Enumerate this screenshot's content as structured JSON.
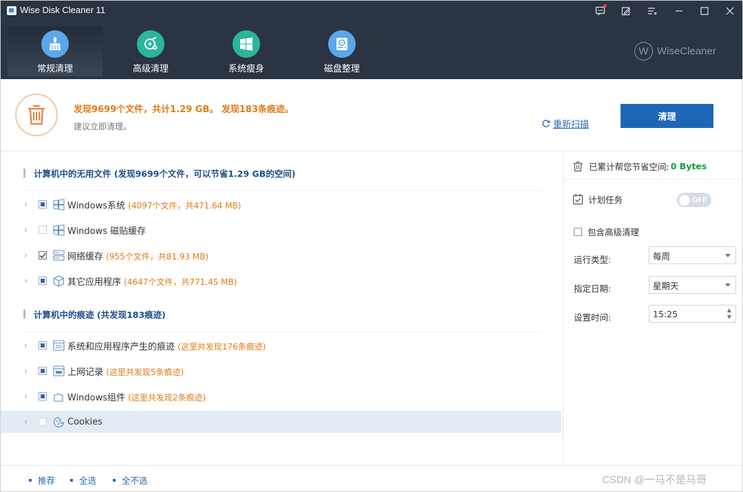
{
  "app": {
    "title": "Wise Disk Cleaner 11"
  },
  "nav": {
    "tabs": [
      {
        "label": "常规清理",
        "active": true,
        "icon": "broom-icon",
        "color": "#5aa7ec"
      },
      {
        "label": "高级清理",
        "active": false,
        "icon": "disc-search-icon",
        "color": "#2bb59a"
      },
      {
        "label": "系统瘦身",
        "active": false,
        "icon": "windows-icon",
        "color": "#2bb59a"
      },
      {
        "label": "磁盘整理",
        "active": false,
        "icon": "hard-disk-icon",
        "color": "#5aa7ec"
      }
    ],
    "logo": "WiseCleaner"
  },
  "summary": {
    "line1": "发现9699个文件，共计1.29 GB。 发现183条痕迹。",
    "line2": "建议立即清理。",
    "rescan": "重新扫描",
    "clean": "清理"
  },
  "sections": [
    {
      "title": "计算机中的无用文件 (发现9699个文件，可以节省1.29 GB的空间)",
      "items": [
        {
          "name": "Windows系统",
          "detail": "(4097个文件，共471.64 MB)",
          "state": "partial",
          "icon": "windows-logo-icon"
        },
        {
          "name": "Windows 磁贴缓存",
          "detail": "",
          "state": "off",
          "icon": "windows-logo-icon"
        },
        {
          "name": "网络缓存",
          "detail": "(955个文件，共81.93 MB)",
          "state": "on",
          "icon": "server-icon"
        },
        {
          "name": "其它应用程序",
          "detail": "(4647个文件，共771.45 MB)",
          "state": "partial",
          "icon": "cube-icon"
        }
      ]
    },
    {
      "title": "计算机中的痕迹 (共发现183痕迹)",
      "items": [
        {
          "name": "系统和应用程序产生的痕迹",
          "detail": "(这里共发现176条痕迹)",
          "state": "partial",
          "icon": "window-list-icon"
        },
        {
          "name": "上网记录",
          "detail": "(这里共发现5条痕迹)",
          "state": "partial",
          "icon": "browser-window-icon"
        },
        {
          "name": "Windows组件",
          "detail": "(这里共发现2条痕迹)",
          "state": "partial",
          "icon": "puzzle-icon"
        },
        {
          "name": "Cookies",
          "detail": "",
          "state": "off",
          "icon": "cookie-icon",
          "selected": true
        }
      ]
    }
  ],
  "right": {
    "saved_label": "已累计帮您节省空间:",
    "saved_value": "0 Bytes",
    "schedule_label": "计划任务",
    "toggle": "OFF",
    "advanced_label": "包含高级清理",
    "run_type_label": "运行类型:",
    "run_type_value": "每周",
    "date_label": "指定日期:",
    "date_value": "星期天",
    "time_label": "设置时间:",
    "time_value": "15:25"
  },
  "footer": {
    "recommend": "推荐",
    "select_all": "全选",
    "select_none": "全不选",
    "watermark": "CSDN @一马不是马哥"
  },
  "colors": {
    "accent": "#1f66b7",
    "orange": "#e07c1a",
    "green": "#1a9c3b",
    "header": "#2a3442"
  }
}
